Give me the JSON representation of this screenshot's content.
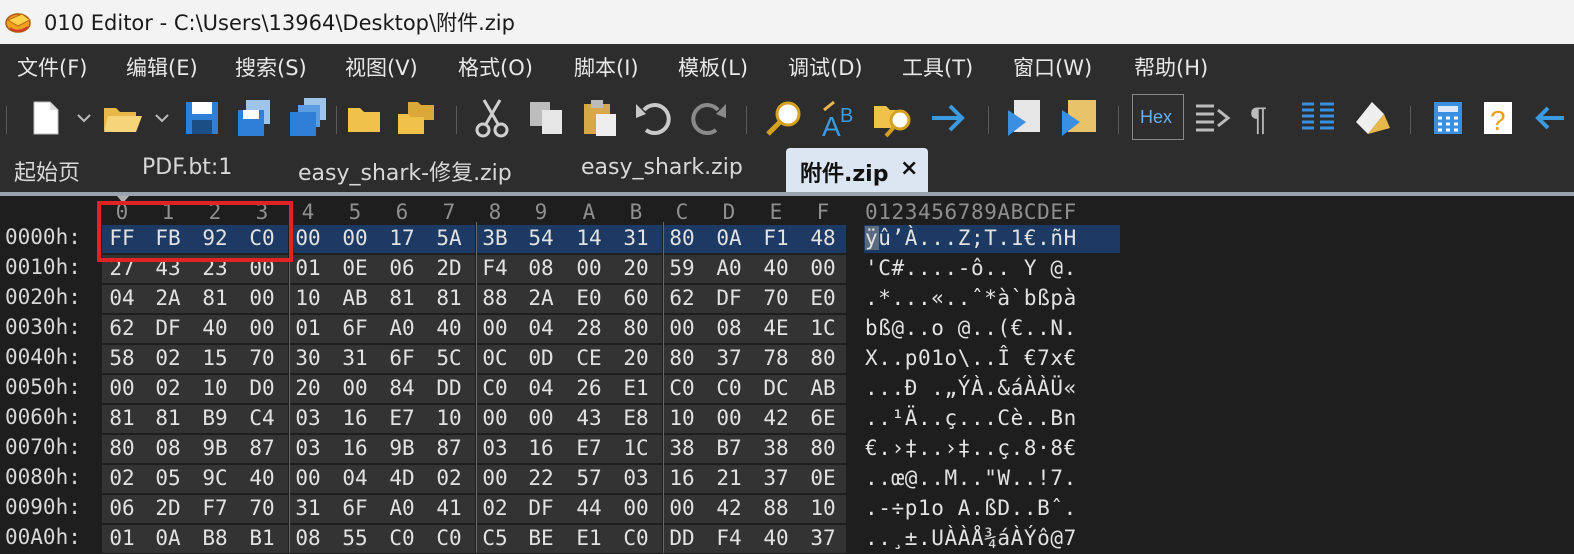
{
  "window": {
    "title": "010 Editor - C:\\Users\\13964\\Desktop\\附件.zip"
  },
  "menu": [
    "文件(F)",
    "编辑(E)",
    "搜索(S)",
    "视图(V)",
    "格式(O)",
    "脚本(I)",
    "模板(L)",
    "调试(D)",
    "工具(T)",
    "窗口(W)",
    "帮助(H)"
  ],
  "toolbar": {
    "icons": [
      "new-file-icon",
      "dropdown-icon",
      "open-folder-icon",
      "dropdown-icon",
      "save-icon",
      "save-as-icon",
      "save-all-icon",
      "folder-icon",
      "open-workspace-icon",
      "cut-icon",
      "copy-icon",
      "paste-icon",
      "undo-icon",
      "redo-icon",
      "find-icon",
      "replace-icon",
      "find-in-files-icon",
      "goto-icon",
      "run-script-icon",
      "run-template-icon",
      "hex-mode-icon",
      "compare-icon",
      "whitespace-icon",
      "columns-icon",
      "highlight-icon",
      "calculator-icon",
      "help-icon",
      "arrow-icon"
    ],
    "hex_label": "Hex"
  },
  "tabs": [
    "起始页",
    "PDF.bt:1",
    "easy_shark-修复.zip",
    "easy_shark.zip"
  ],
  "active_tab": {
    "label": "附件.zip",
    "close": "×"
  },
  "hex": {
    "col_headers": [
      "0",
      "1",
      "2",
      "3",
      "4",
      "5",
      "6",
      "7",
      "8",
      "9",
      "A",
      "B",
      "C",
      "D",
      "E",
      "F"
    ],
    "ascii_header": "0123456789ABCDEF",
    "rows": [
      {
        "addr": "0000h:",
        "bytes": [
          "FF",
          "FB",
          "92",
          "C0",
          "00",
          "00",
          "17",
          "5A",
          "3B",
          "54",
          "14",
          "31",
          "80",
          "0A",
          "F1",
          "48"
        ],
        "ascii": "ÿû’À...Z;T.1€.ñH"
      },
      {
        "addr": "0010h:",
        "bytes": [
          "27",
          "43",
          "23",
          "00",
          "01",
          "0E",
          "06",
          "2D",
          "F4",
          "08",
          "00",
          "20",
          "59",
          "A0",
          "40",
          "00"
        ],
        "ascii": "'C#....-ô.. Y @."
      },
      {
        "addr": "0020h:",
        "bytes": [
          "04",
          "2A",
          "81",
          "00",
          "10",
          "AB",
          "81",
          "81",
          "88",
          "2A",
          "E0",
          "60",
          "62",
          "DF",
          "70",
          "E0"
        ],
        "ascii": ".*...«..ˆ*à`bßpà"
      },
      {
        "addr": "0030h:",
        "bytes": [
          "62",
          "DF",
          "40",
          "00",
          "01",
          "6F",
          "A0",
          "40",
          "00",
          "04",
          "28",
          "80",
          "00",
          "08",
          "4E",
          "1C"
        ],
        "ascii": "bß@..o @..(€..N."
      },
      {
        "addr": "0040h:",
        "bytes": [
          "58",
          "02",
          "15",
          "70",
          "30",
          "31",
          "6F",
          "5C",
          "0C",
          "0D",
          "CE",
          "20",
          "80",
          "37",
          "78",
          "80"
        ],
        "ascii": "X..p01o\\..Î €7x€"
      },
      {
        "addr": "0050h:",
        "bytes": [
          "00",
          "02",
          "10",
          "D0",
          "20",
          "00",
          "84",
          "DD",
          "C0",
          "04",
          "26",
          "E1",
          "C0",
          "C0",
          "DC",
          "AB"
        ],
        "ascii": "...Ð .„ÝÀ.&áÀÀÜ«"
      },
      {
        "addr": "0060h:",
        "bytes": [
          "81",
          "81",
          "B9",
          "C4",
          "03",
          "16",
          "E7",
          "10",
          "00",
          "00",
          "43",
          "E8",
          "10",
          "00",
          "42",
          "6E"
        ],
        "ascii": "..¹Ä..ç...Cè..Bn"
      },
      {
        "addr": "0070h:",
        "bytes": [
          "80",
          "08",
          "9B",
          "87",
          "03",
          "16",
          "9B",
          "87",
          "03",
          "16",
          "E7",
          "1C",
          "38",
          "B7",
          "38",
          "80"
        ],
        "ascii": "€.›‡..›‡..ç.8·8€"
      },
      {
        "addr": "0080h:",
        "bytes": [
          "02",
          "05",
          "9C",
          "40",
          "00",
          "04",
          "4D",
          "02",
          "00",
          "22",
          "57",
          "03",
          "16",
          "21",
          "37",
          "0E"
        ],
        "ascii": "..œ@..M..\"W..!7."
      },
      {
        "addr": "0090h:",
        "bytes": [
          "06",
          "2D",
          "F7",
          "70",
          "31",
          "6F",
          "A0",
          "41",
          "02",
          "DF",
          "44",
          "00",
          "00",
          "42",
          "88",
          "10"
        ],
        "ascii": ".-÷p1o A.ßD..Bˆ."
      },
      {
        "addr": "00A0h:",
        "bytes": [
          "01",
          "0A",
          "B8",
          "B1",
          "08",
          "55",
          "C0",
          "C0",
          "C5",
          "BE",
          "E1",
          "C0",
          "DD",
          "F4",
          "40",
          "37"
        ],
        "ascii": "..¸±.UÀÀÅ¾áÀÝô@7"
      }
    ]
  },
  "colors": {
    "accent": "#1c3a63",
    "highlight_box": "#e02424",
    "active_tab": "#dce6f2"
  }
}
